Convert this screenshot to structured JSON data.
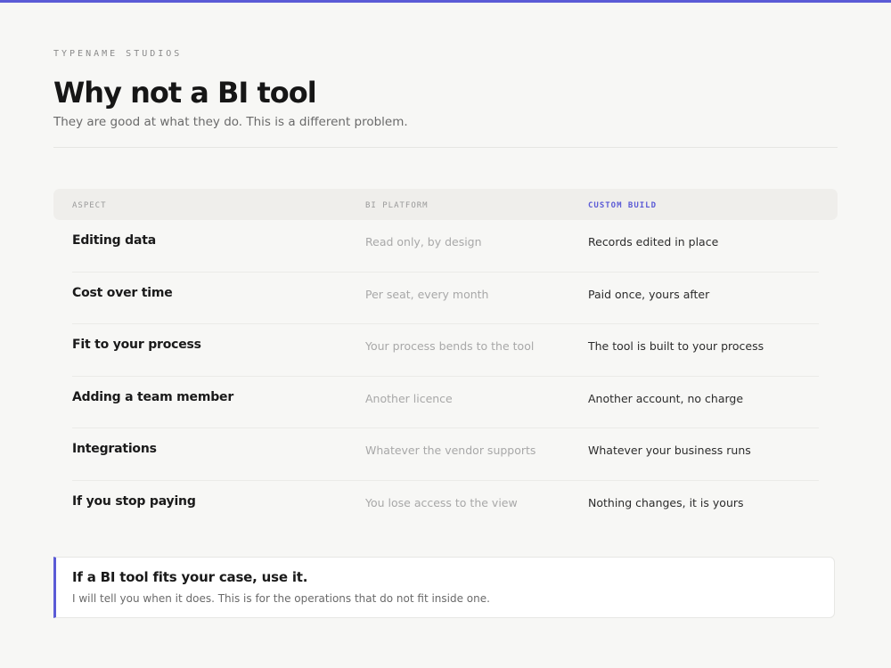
{
  "header": {
    "brand": "TYPENAME STUDIOS",
    "title": "Why not a BI tool",
    "subtitle": "They are good at what they do. This is a different problem."
  },
  "table": {
    "columns": [
      "ASPECT",
      "BI PLATFORM",
      "CUSTOM BUILD"
    ],
    "rows": [
      {
        "aspect": "Editing data",
        "bi": "Read only, by design",
        "custom": "Records edited in place"
      },
      {
        "aspect": "Cost over time",
        "bi": "Per seat, every month",
        "custom": "Paid once, yours after"
      },
      {
        "aspect": "Fit to your process",
        "bi": "Your process bends to the tool",
        "custom": "The tool is built to your process"
      },
      {
        "aspect": "Adding a team member",
        "bi": "Another licence",
        "custom": "Another account, no charge"
      },
      {
        "aspect": "Integrations",
        "bi": "Whatever the vendor supports",
        "custom": "Whatever your business runs"
      },
      {
        "aspect": "If you stop paying",
        "bi": "You lose access to the view",
        "custom": "Nothing changes, it is yours"
      }
    ]
  },
  "callout": {
    "title": "If a BI tool fits your case, use it.",
    "text": "I will tell you when it does. This is for the operations that do not fit inside one."
  },
  "colors": {
    "accent": "#5b5bd6",
    "background": "#f7f7f5",
    "header_row": "#efeeeb"
  }
}
